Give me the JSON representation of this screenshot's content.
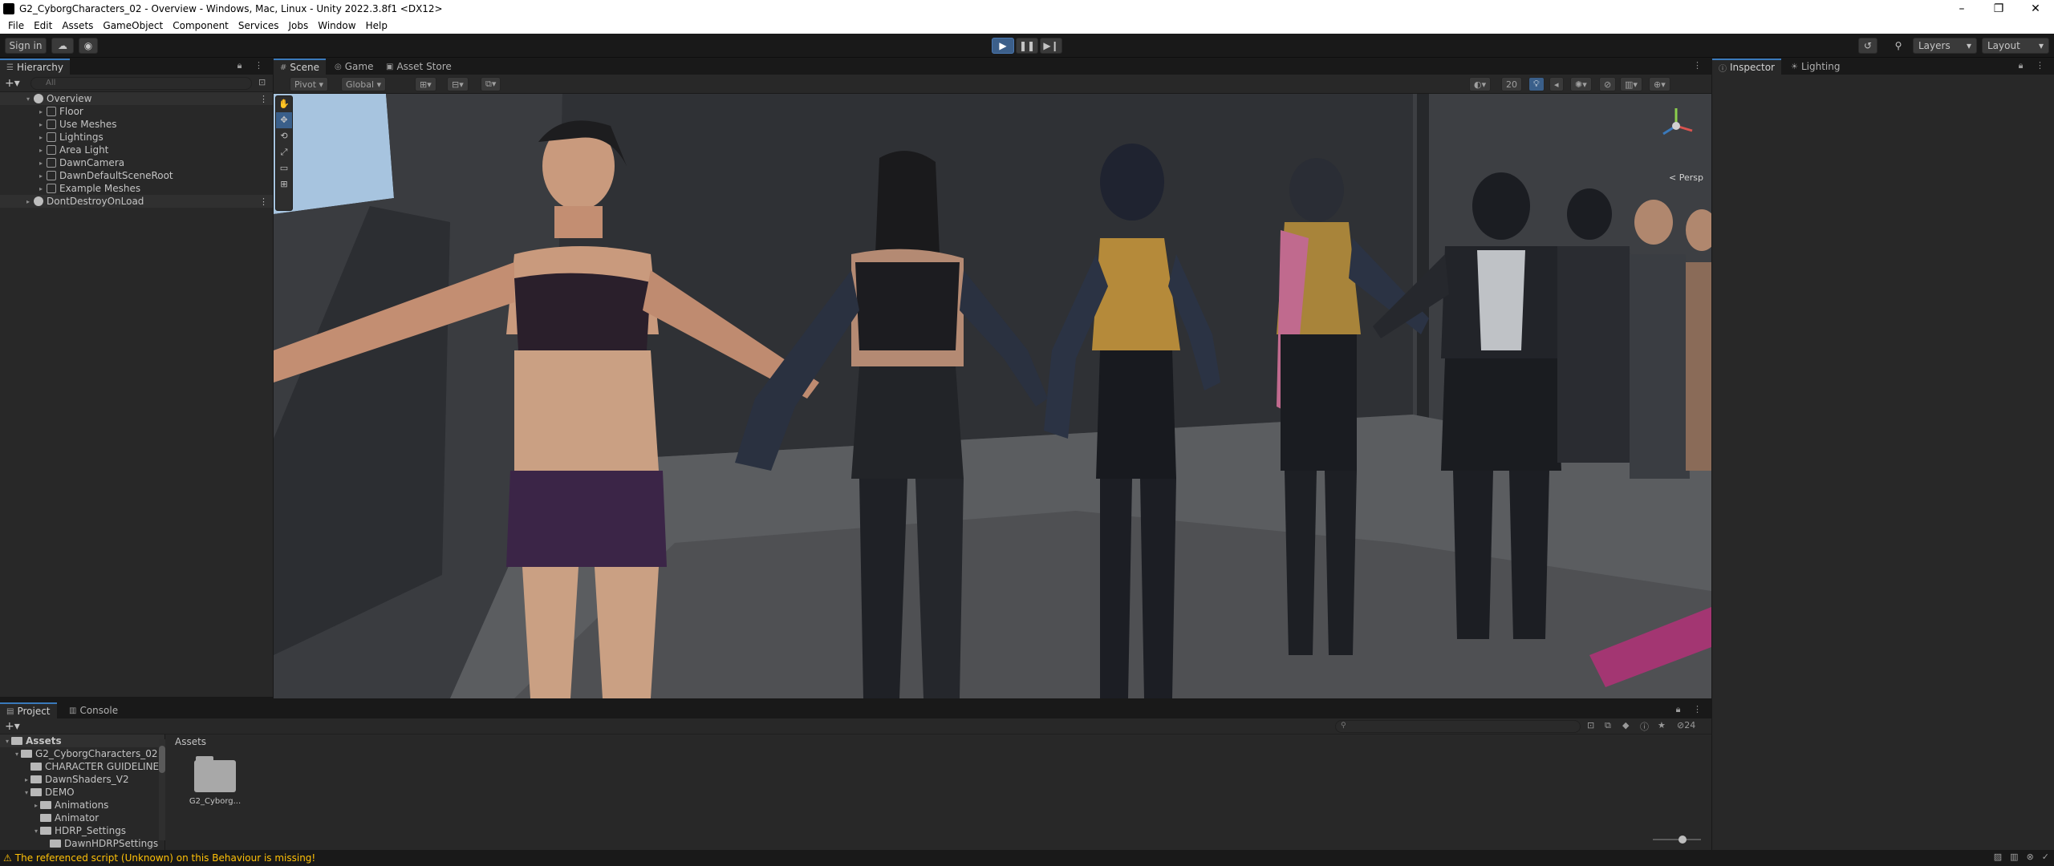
{
  "window": {
    "title": "G2_CyborgCharacters_02 - Overview - Windows, Mac, Linux - Unity 2022.3.8f1 <DX12>",
    "controls": [
      "–",
      "❐",
      "✕"
    ]
  },
  "menu": [
    "File",
    "Edit",
    "Assets",
    "GameObject",
    "Component",
    "Services",
    "Jobs",
    "Window",
    "Help"
  ],
  "toolbar": {
    "sign_in": "Sign in",
    "cloud_icon": "☁",
    "collab_icon": "◉",
    "play": "▶",
    "pause": "❚❚",
    "step": "▶❙",
    "history_icon": "↺",
    "search_icon": "⚲",
    "layers": "Layers",
    "layout": "Layout",
    "dropdown_icon": "▾",
    "play_color": "#3c5f8a"
  },
  "hierarchy": {
    "tab_label": "Hierarchy",
    "tab_icon": "☰",
    "search_placeholder": "All",
    "scenes": [
      {
        "label": "Overview",
        "expanded": true,
        "children": [
          "Floor",
          "Use Meshes",
          "Lightings",
          "Area Light",
          "DawnCamera",
          "DawnDefaultSceneRoot",
          "Example Meshes"
        ]
      },
      {
        "label": "DontDestroyOnLoad",
        "expanded": false,
        "children": []
      }
    ]
  },
  "scene_view": {
    "tabs": [
      {
        "label": "Scene",
        "icon": "#"
      },
      {
        "label": "Game",
        "icon": "◎"
      },
      {
        "label": "Asset Store",
        "icon": "▣"
      }
    ],
    "pivot": "Pivot",
    "global": "Global",
    "camera_mode": "Persp",
    "scale_value": "20",
    "tools": [
      "✋",
      "✥",
      "⟲",
      "⤢",
      "▭",
      "⊞"
    ],
    "axis_colors": {
      "x": "#d9534f",
      "y": "#8ccf4d",
      "z": "#3a79bb"
    }
  },
  "inspector": {
    "tabs": [
      {
        "label": "Inspector",
        "icon": "ⓘ"
      },
      {
        "label": "Lighting",
        "icon": "☀"
      }
    ]
  },
  "project": {
    "tabs": [
      {
        "label": "Project",
        "icon": "▤"
      },
      {
        "label": "Console",
        "icon": "▥"
      }
    ],
    "hidden_count": "24",
    "tree": [
      {
        "label": "Assets",
        "depth": 0,
        "arrow": "▾",
        "header": true
      },
      {
        "label": "G2_CyborgCharacters_02",
        "depth": 1,
        "arrow": "▾"
      },
      {
        "label": "CHARACTER GUIDELINE",
        "depth": 2,
        "arrow": ""
      },
      {
        "label": "DawnShaders_V2",
        "depth": 2,
        "arrow": "▸"
      },
      {
        "label": "DEMO",
        "depth": 2,
        "arrow": "▾"
      },
      {
        "label": "Animations",
        "depth": 3,
        "arrow": "▸"
      },
      {
        "label": "Animator",
        "depth": 3,
        "arrow": ""
      },
      {
        "label": "HDRP_Settings",
        "depth": 3,
        "arrow": "▾"
      },
      {
        "label": "DawnHDRPSettings",
        "depth": 4,
        "arrow": ""
      }
    ],
    "breadcrumb": "Assets",
    "assets": [
      {
        "name": "G2_Cyborg..."
      }
    ]
  },
  "status": {
    "message": "The referenced script (Unknown) on this Behaviour is missing!",
    "warning_color": "#ffc107"
  }
}
